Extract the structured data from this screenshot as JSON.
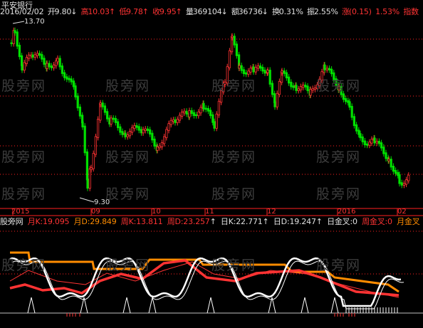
{
  "stock": {
    "name": "平安银行",
    "date": "2016/02/02",
    "open_label": "开",
    "open": "9.80",
    "high_label": "高",
    "high": "10.03",
    "low_label": "低",
    "low": "9.78",
    "close_label": "收",
    "close": "9.95",
    "volume_label": "量",
    "volume": "369104",
    "amount_label": "额",
    "amount": "36736",
    "turnover_label": "换",
    "turnover": "0.31%",
    "amplitude_label": "振",
    "amplitude": "2.55%",
    "change_label": "涨",
    "change": "(0.15)",
    "change_pct": "1.53%",
    "index_label": "指数"
  },
  "price_marks": {
    "high": "13.70",
    "low": "9.30"
  },
  "watermark": "股旁网",
  "axis_labels": [
    "2015",
    "09",
    "10",
    "11",
    "12",
    "2016",
    "02"
  ],
  "indicator": {
    "name": "股旁网",
    "monthK_label": "月K:",
    "monthK": "19.095",
    "monthD_label": "月D:",
    "monthD": "29.849",
    "weekK_label": "周K:",
    "weekK": "13.811",
    "weekD_label": "周D:",
    "weekD": "23.257",
    "dayK_label": "日K:",
    "dayK": "22.771",
    "dayD_label": "日D:",
    "dayD": "19.247",
    "dayGold_label": "日金叉:",
    "dayGold": "0",
    "weekGold_label": "周金叉:",
    "weekGold": "0",
    "monthGold_label": "月金叉"
  },
  "colors": {
    "up": "#ff3333",
    "down": "#00e000",
    "white": "#ffffff",
    "orange": "#ff8c00",
    "grid": "#ff2020"
  }
}
